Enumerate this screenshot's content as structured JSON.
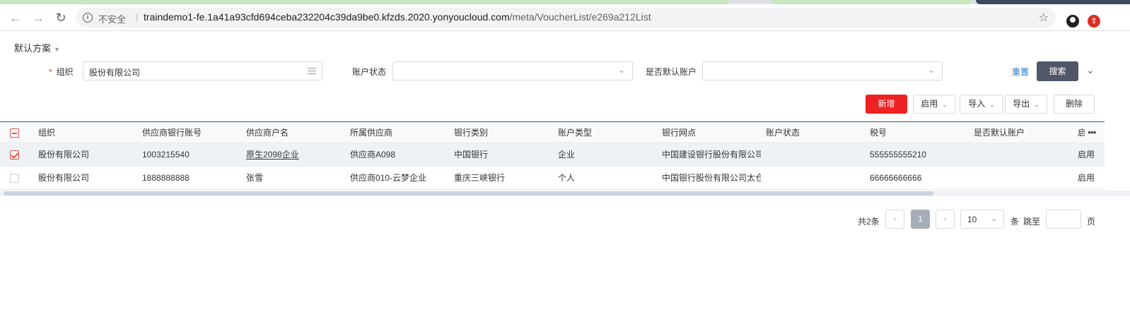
{
  "browser": {
    "insecure_label": "不安全",
    "url_host": "traindemo1-fe.1a41a93cfd694ceba232204c39da9be0.kfzds.2020.yonyoucloud.com",
    "url_path": "/meta/VoucherList/e269a212List"
  },
  "scheme": {
    "label": "默认方案"
  },
  "filters": {
    "org_label": "组织",
    "org_value": "股份有限公司",
    "status_label": "账户状态",
    "status_value": "",
    "default_label": "是否默认账户",
    "default_value": "",
    "reset_label": "重置",
    "search_label": "搜索"
  },
  "actions": {
    "add": "新增",
    "enable": "启用",
    "import": "导入",
    "export": "导出",
    "delete": "删除"
  },
  "table": {
    "headers": [
      "组织",
      "供应商银行账号",
      "供应商户名",
      "所属供应商",
      "银行类别",
      "账户类型",
      "银行网点",
      "账户状态",
      "税号",
      "是否默认账户",
      "启"
    ],
    "rows": [
      {
        "selected": true,
        "cells": [
          "股份有限公司",
          "1003215540",
          "原生2098企业",
          "供应商A098",
          "中国银行",
          "企业",
          "中国建设银行股份有限公司",
          "",
          "555555555210",
          "",
          "启用"
        ]
      },
      {
        "selected": false,
        "cells": [
          "股份有限公司",
          "1888888888",
          "张雪",
          "供应商010-云梦企业",
          "重庆三峡银行",
          "个人",
          "中国银行股份有限公司太仓",
          "",
          "66666666666",
          "",
          "启用"
        ]
      }
    ]
  },
  "pagination": {
    "total": "共2条",
    "current_page": "1",
    "page_size": "10",
    "unit": "条",
    "jump_label": "跳至",
    "page_unit": "页"
  }
}
